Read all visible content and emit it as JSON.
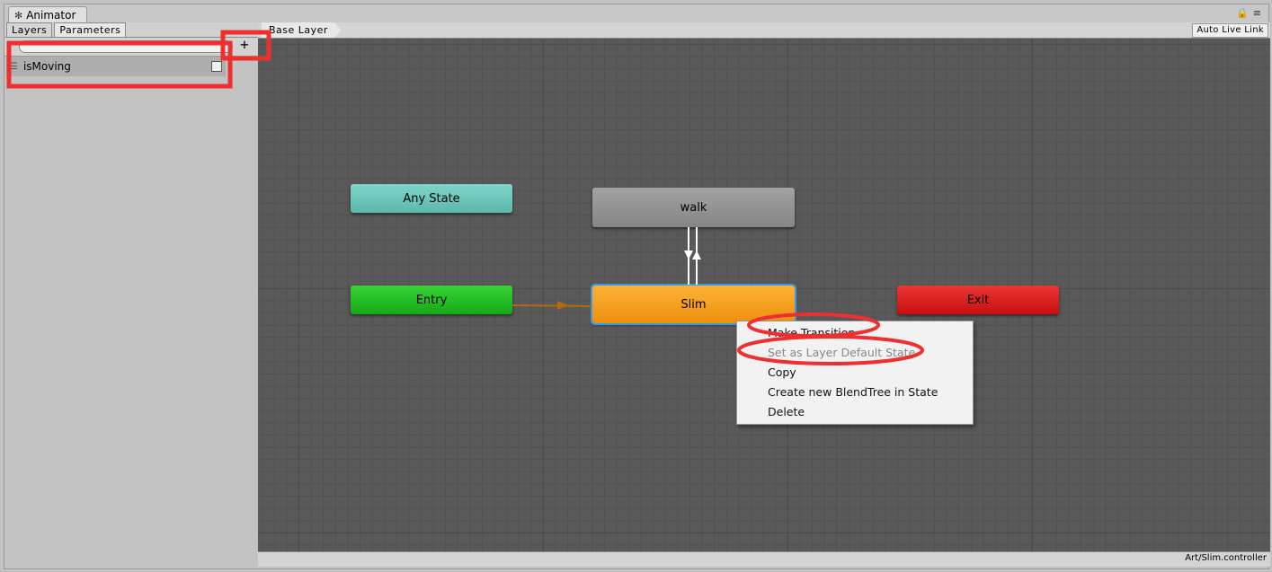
{
  "window": {
    "title": "Animator"
  },
  "left_panel": {
    "tabs": [
      {
        "label": "Layers"
      },
      {
        "label": "Parameters"
      }
    ],
    "add_button": "+",
    "parameters": [
      {
        "name": "isMoving",
        "value": false
      }
    ]
  },
  "graph": {
    "breadcrumb": "Base Layer",
    "auto_live_link": "Auto Live Link",
    "footer_path": "Art/Slim.controller",
    "states": {
      "any_state": "Any State",
      "walk": "walk",
      "entry": "Entry",
      "slim": "Slim",
      "exit": "Exit"
    }
  },
  "context_menu": {
    "items": [
      {
        "label": "Make Transition",
        "enabled": true
      },
      {
        "label": "Set as Layer Default State",
        "enabled": false
      },
      {
        "label": "Copy",
        "enabled": true
      },
      {
        "label": "Create new BlendTree in State",
        "enabled": true
      },
      {
        "label": "Delete",
        "enabled": true
      }
    ]
  },
  "colors": {
    "annotation_red": "#ee2f2f",
    "any_state": "#6cc4b8",
    "entry": "#1fb522",
    "slim": "#f39a1a",
    "exit": "#d61515",
    "walk": "#8e8e8e",
    "selection": "#3c9be8"
  }
}
